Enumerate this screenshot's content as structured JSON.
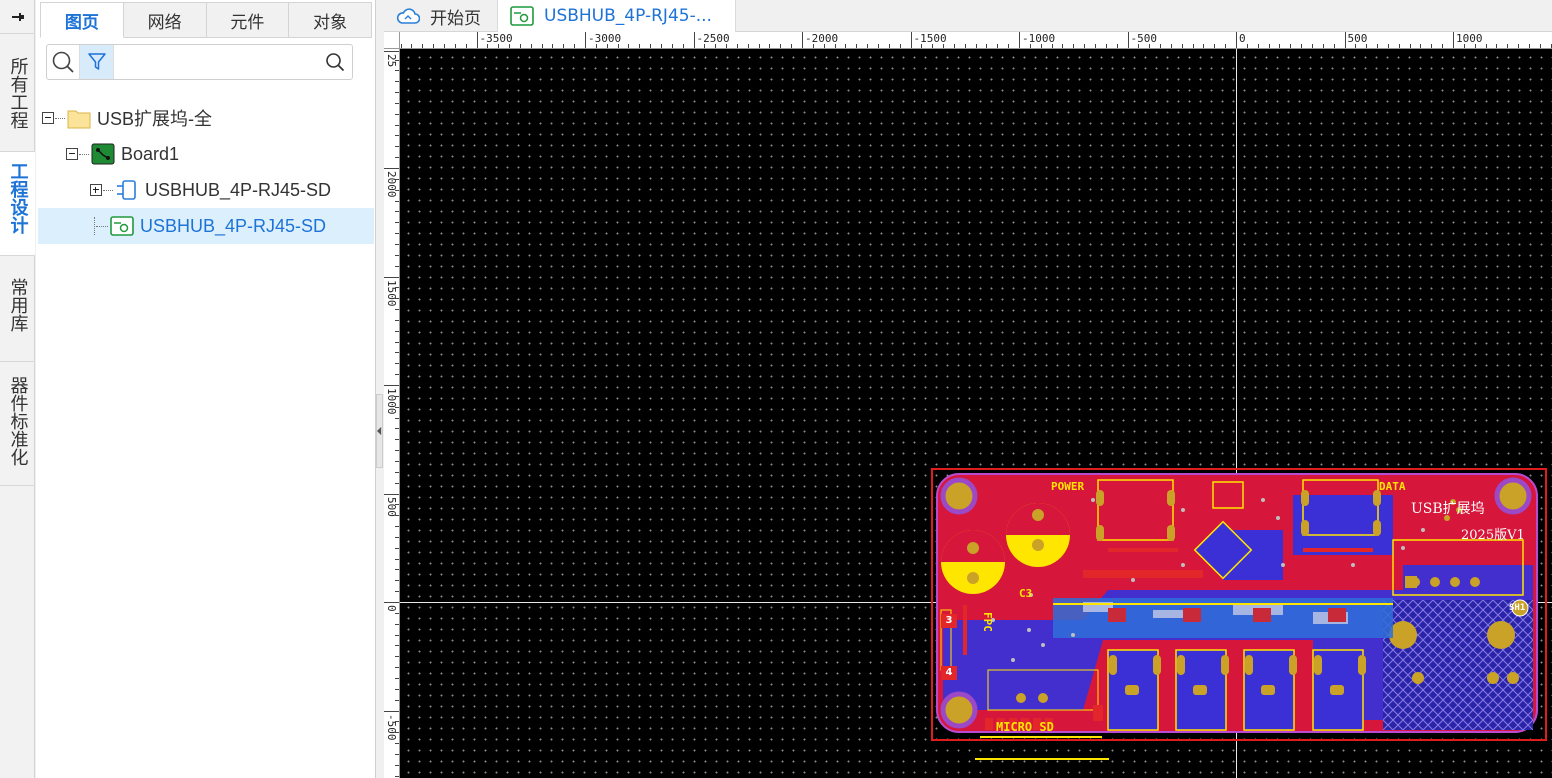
{
  "app": {
    "pin_icon": "pin-icon",
    "vertical_tabs": [
      {
        "label": "所有工程",
        "active": false
      },
      {
        "label": "工程设计",
        "active": true
      },
      {
        "label": "常用库",
        "active": false
      },
      {
        "label": "器件标准化",
        "active": false
      }
    ]
  },
  "panel": {
    "tabs": [
      "图页",
      "网络",
      "元件",
      "对象"
    ],
    "active_tab": "图页",
    "search": {
      "value": "",
      "placeholder": ""
    },
    "tree": [
      {
        "label": "USB扩展坞-全",
        "icon": "folder-icon",
        "expander": "minus"
      },
      {
        "label": "Board1",
        "icon": "board-icon",
        "expander": "minus"
      },
      {
        "label": "USBHUB_4P-RJ45-SD",
        "icon": "schematic-icon",
        "expander": "plus"
      },
      {
        "label": "USBHUB_4P-RJ45-SD",
        "icon": "pcb-icon",
        "expander": "none",
        "selected": true
      }
    ]
  },
  "doc_tabs": [
    {
      "label": "开始页",
      "icon": "cloud-icon",
      "active": false
    },
    {
      "label": "USBHUB_4P-RJ45-...",
      "icon": "pcb-icon",
      "active": true
    }
  ],
  "rulers": {
    "horizontal": [
      "-3500",
      "-3000",
      "-2500",
      "-2000",
      "-1500",
      "-1000",
      "-500",
      "0",
      "500",
      "1000"
    ],
    "vertical": [
      "25",
      "2000",
      "1500",
      "1000",
      "500",
      "0",
      "-500"
    ]
  },
  "board": {
    "silkscreen": {
      "power": "POWER",
      "data": "DATA",
      "title": "USB扩展坞",
      "version": "2025版V1",
      "micro_sd": "MICRO  SD",
      "fpc": "FPC",
      "c3": "C3",
      "sh1": "SH1",
      "pin3": "3",
      "pin4": "4"
    },
    "colors": {
      "top_copper": "#d6163a",
      "bottom_copper": "#3b2fd6",
      "silkscreen": "#ffe600",
      "outline": "#e01c1c",
      "pads": "#c9a227"
    }
  }
}
